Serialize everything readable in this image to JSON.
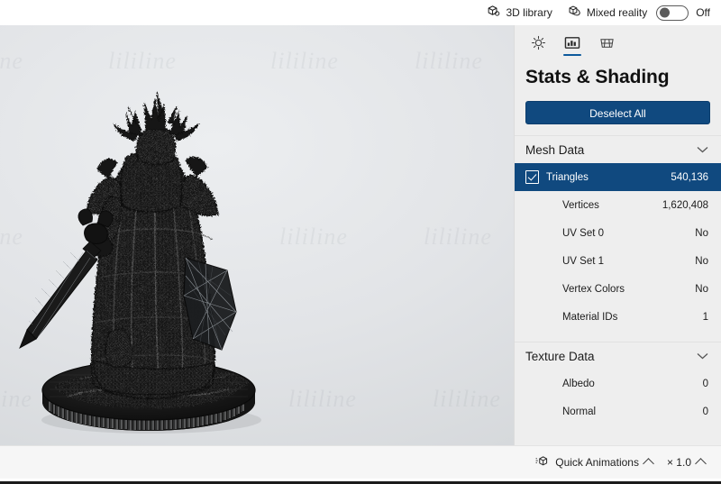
{
  "topbar": {
    "library_label": "3D library",
    "library_icon": "cube-library-icon",
    "mixed_reality_label": "Mixed reality",
    "mixed_reality_icon": "mixed-reality-icon",
    "toggle_state_label": "Off"
  },
  "panel": {
    "title": "Stats & Shading",
    "deselect_label": "Deselect All",
    "tabs": [
      {
        "name": "lighting",
        "icon": "sun-icon",
        "active": false
      },
      {
        "name": "stats-shading",
        "icon": "stats-icon",
        "active": true
      },
      {
        "name": "wireframe",
        "icon": "grid-icon",
        "active": false
      }
    ],
    "sections": [
      {
        "title": "Mesh Data",
        "chevron": "chevron-down-icon",
        "rows": [
          {
            "label": "Triangles",
            "value": "540,136",
            "selected": true
          },
          {
            "label": "Vertices",
            "value": "1,620,408",
            "selected": false
          },
          {
            "label": "UV Set 0",
            "value": "No",
            "selected": false
          },
          {
            "label": "UV Set 1",
            "value": "No",
            "selected": false
          },
          {
            "label": "Vertex Colors",
            "value": "No",
            "selected": false
          },
          {
            "label": "Material IDs",
            "value": "1",
            "selected": false
          }
        ]
      },
      {
        "title": "Texture Data",
        "chevron": "chevron-down-icon",
        "rows": [
          {
            "label": "Albedo",
            "value": "0",
            "selected": false
          },
          {
            "label": "Normal",
            "value": "0",
            "selected": false
          }
        ]
      }
    ]
  },
  "bottombar": {
    "quick_animations_label": "Quick Animations",
    "quick_animations_icon": "animation-cube-icon",
    "zoom_label": "× 1.0"
  },
  "colors": {
    "accent": "#10497f",
    "tab_underline": "#0d5a9c",
    "panel_bg": "#eeeeee",
    "viewport_bg": "#e2e4e7"
  }
}
